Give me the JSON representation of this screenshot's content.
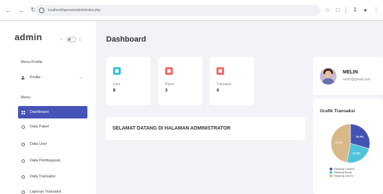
{
  "browser": {
    "url": "localhost/laporan/admin/index.php",
    "back_icon": "back-arrow-icon",
    "forward_icon": "forward-arrow-icon",
    "reload_icon": "reload-icon"
  },
  "sidebar": {
    "brand": "admin",
    "menu_profile_heading": "Menu Profile",
    "profile_item": "Profile",
    "menu_heading": "Menu",
    "items": [
      {
        "label": "Dashboard",
        "icon": "grid-icon",
        "active": true
      },
      {
        "label": "Data Paket",
        "icon": "disc-icon"
      },
      {
        "label": "Data User",
        "icon": "disc-icon"
      },
      {
        "label": "Data Pembayaran",
        "icon": "disc-icon"
      },
      {
        "label": "Data Transaksi",
        "icon": "disc-icon"
      },
      {
        "label": "Laporan Transaksi",
        "icon": "disc-icon"
      }
    ]
  },
  "main": {
    "title": "Dashboard",
    "stats": [
      {
        "label": "User",
        "value": "8",
        "color": "#3cc0d8"
      },
      {
        "label": "Paket",
        "value": "3",
        "color": "#f46a6a"
      },
      {
        "label": "Transaksi",
        "value": "4",
        "color": "#f46a6a"
      }
    ],
    "welcome": "SELAMAT DATANG DI HALAMAN ADMINISTRATOR"
  },
  "profile": {
    "name": "MELIN",
    "email": "melin@gmail.com"
  },
  "chart_data": {
    "type": "pie",
    "title": "Grafik Transaksi",
    "labels": [
      "Ranjang Custom",
      "Ranjang Besar",
      "Ranjang Umum"
    ],
    "values": [
      29.4,
      23.5,
      47.1
    ],
    "value_labels": [
      "29.4%",
      "23.5%",
      "47.1%"
    ],
    "colors": [
      "#4353b5",
      "#4fc3d9",
      "#d8b98a"
    ]
  }
}
